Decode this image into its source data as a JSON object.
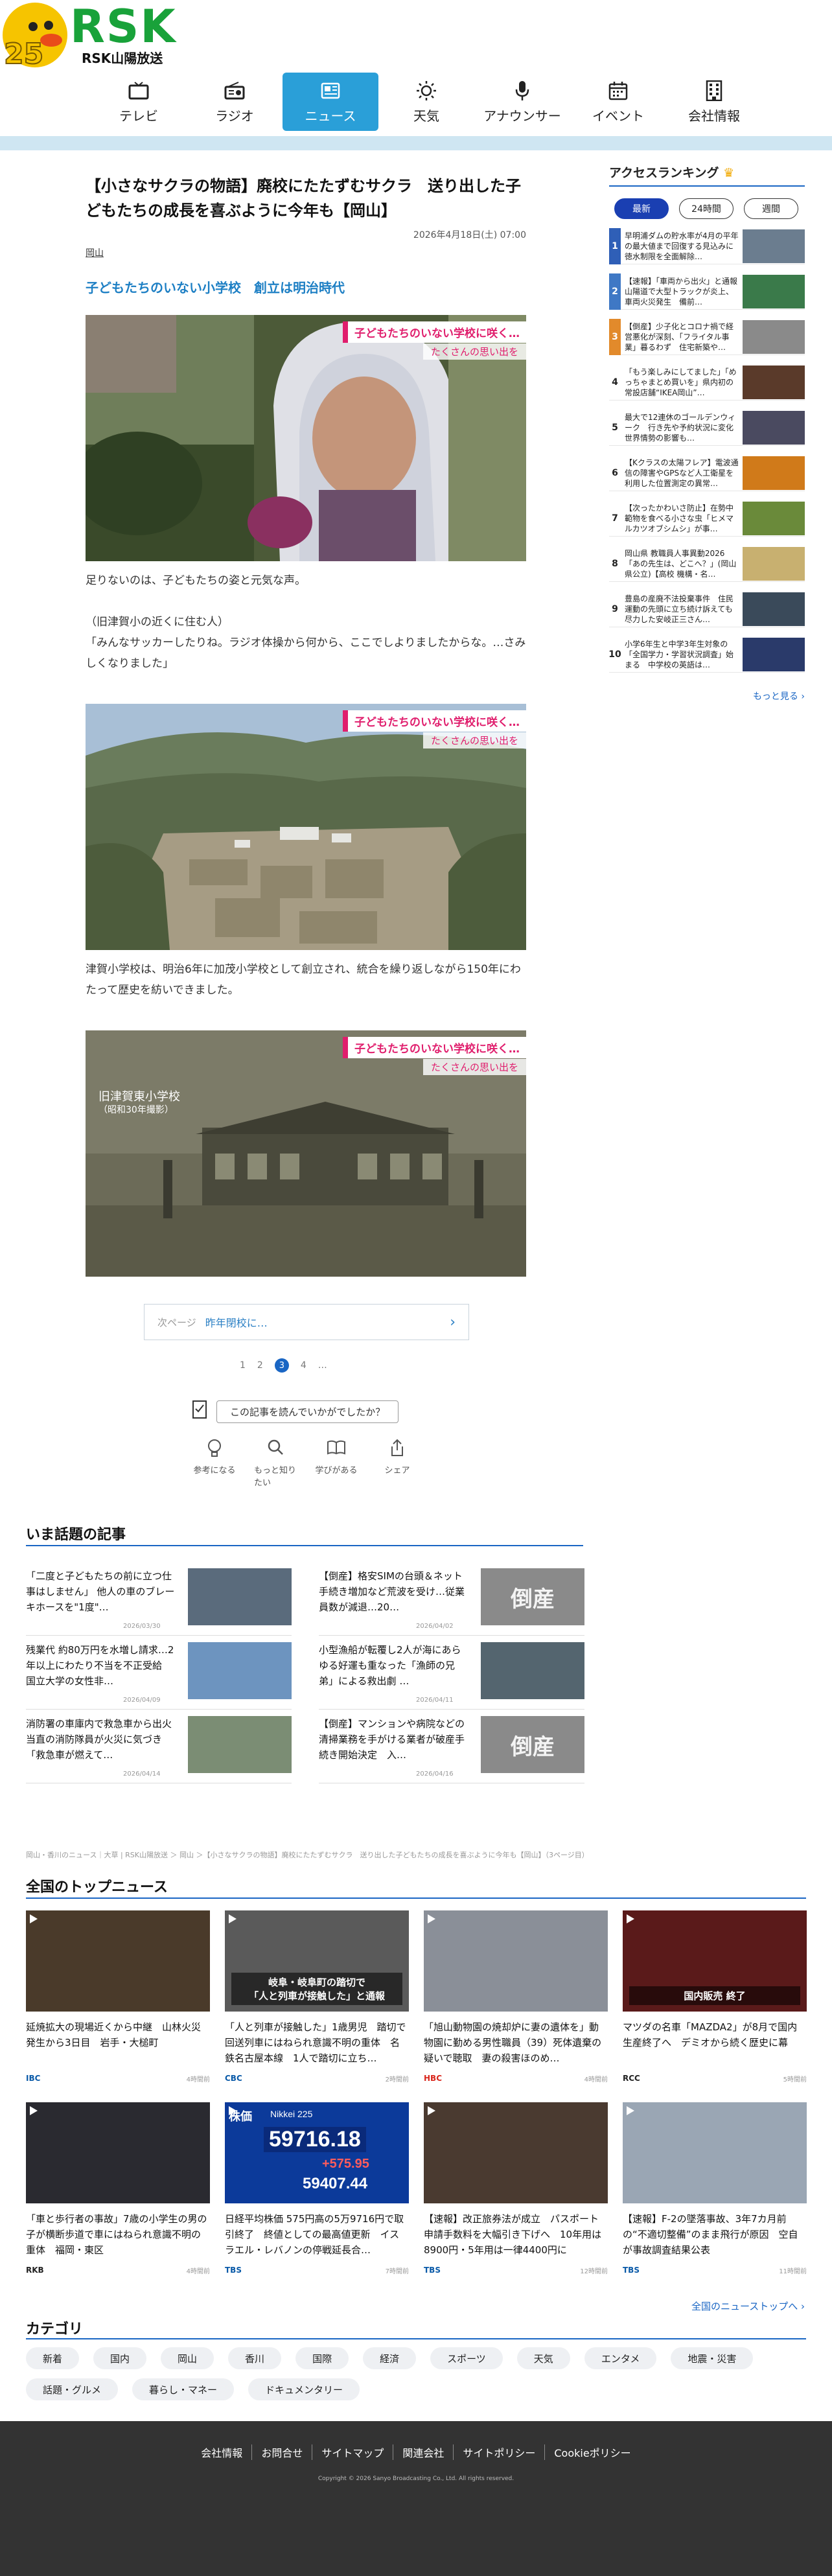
{
  "brand": {
    "logo_text": "RSK",
    "subtitle": "RSK山陽放送",
    "anniversary": "25"
  },
  "nav": [
    {
      "label": "テレビ",
      "icon": "tv-icon"
    },
    {
      "label": "ラジオ",
      "icon": "radio-icon"
    },
    {
      "label": "ニュース",
      "icon": "news-icon",
      "active": true
    },
    {
      "label": "天気",
      "icon": "sun-icon"
    },
    {
      "label": "アナウンサー",
      "icon": "microphone-icon"
    },
    {
      "label": "イベント",
      "icon": "calendar-icon"
    },
    {
      "label": "会社情報",
      "icon": "building-icon"
    }
  ],
  "article": {
    "title": "【小さなサクラの物語】廃校にたたずむサクラ　送り出した子どもたちの成長を喜ぶように今年も【岡山】",
    "date": "2026年4月18日(土) 07:00",
    "category": "岡山",
    "subheading": "子どもたちのいない小学校　創立は明治時代",
    "photo_caption_main": "子どもたちのいない学校に咲く…",
    "photo_caption_sub": "たくさんの思い出を",
    "photo3_label_line1": "旧津賀東小学校",
    "photo3_label_line2": "（昭和30年撮影）",
    "para1": "足りないのは、子どもたちの姿と元気な声。",
    "para2": "（旧津賀小の近くに住む人）\n「みんなサッカーしたりね。ラジオ体操から何から、ここでしよりましたからな。…さみしくなりました」",
    "para3": "津賀小学校は、明治6年に加茂小学校として創立され、統合を繰り返しながら150年にわたって歴史を紡いできました。"
  },
  "pager": {
    "next_label": "次ページ",
    "next_title": "昨年閉校に…",
    "pages": [
      "1",
      "2",
      "3",
      "4",
      "…"
    ],
    "current": "3"
  },
  "feedback": {
    "question": "この記事を読んでいかがでしたか？",
    "reactions": [
      {
        "label": "参考になる",
        "icon": "lightbulb-icon"
      },
      {
        "label": "もっと知りたい",
        "icon": "search-icon"
      },
      {
        "label": "学びがある",
        "icon": "book-icon"
      },
      {
        "label": "シェア",
        "icon": "share-icon"
      }
    ]
  },
  "sidebar": {
    "heading": "アクセスランキング",
    "tabs": [
      "最新",
      "24時間",
      "週間"
    ],
    "more": "もっと見る ›",
    "items": [
      {
        "rank": "1",
        "text": "早明浦ダムの貯水率が4月の平年の最大値まで回復する見込みに　徳水制限を全面解除…",
        "badge": "#2f5fb7"
      },
      {
        "rank": "2",
        "text": "【速報】「車両から出火」と通報　山陽道で大型トラックが炎上、車両火災発生　備前…",
        "badge": "#3f78c5"
      },
      {
        "rank": "3",
        "text": "【倒産】少子化とコロナ禍で経営悪化が深刻、「フライタル事業」暮るわず　住宅新築や…",
        "badge": "#e28a2b"
      },
      {
        "rank": "4",
        "text": "「もう楽しみにしてました」「めっちゃまとめ買いを」県内初の常設店舗“IKEA岡山”…",
        "badge": ""
      },
      {
        "rank": "5",
        "text": "最大で12連休のゴールデンウィーク　行き先や予約状況に変化　世界情勢の影響も…",
        "badge": ""
      },
      {
        "rank": "6",
        "text": "【Kクラスの太陽フレア】電波通信の障害やGPSなど人工衛星を利用した位置測定の異常…",
        "badge": ""
      },
      {
        "rank": "7",
        "text": "【次ったかわいさ防止】在勢中範物を食べる小さな虫「ヒメマルカツオブシムシ」が事…",
        "badge": ""
      },
      {
        "rank": "8",
        "text": "岡山県 教職員人事異動2026「あの先生は、どこへ？」(岡山県公立)【高校 機構・名…",
        "badge": ""
      },
      {
        "rank": "9",
        "text": "豊島の産廃不法投棄事件　住民運動の先頭に立ち続け訴えても尽力した安岐正三さん…",
        "badge": ""
      },
      {
        "rank": "10",
        "text": "小学6年生と中学3年生対象の「全国学力・学習状況調査」始まる　中学校の英語は…",
        "badge": ""
      }
    ]
  },
  "trending": {
    "heading": "いま話題の記事",
    "items": [
      {
        "title": "「二度と子どもたちの前に立つ仕事はしません」 他人の車のブレーキホースを\"1度\"…",
        "date": "2026/03/30",
        "img": "#5a6b7c"
      },
      {
        "title": "【倒産】格安SIMの台頭＆ネット手続き増加など荒波を受け…従業員数が減退…20…",
        "date": "2026/04/02",
        "img": "#8a8a8a",
        "img_text": "倒産"
      },
      {
        "title": "残業代 約80万円を水増し請求…2年以上にわたり不当を不正受給　国立大学の女性非…",
        "date": "2026/04/09",
        "img": "#6d94bf"
      },
      {
        "title": "小型漁船が転覆し2人が海にあらゆる好運も重なった「漁師の兄弟」による救出劇 …",
        "date": "2026/04/11",
        "img": "#54656f"
      },
      {
        "title": "消防署の車庫内で救急車から出火　当直の消防隊員が火災に気づき「救急車が燃えて…",
        "date": "2026/04/14",
        "img": "#7b8d74"
      },
      {
        "title": "【倒産】マンションや病院などの清掃業務を手がける業者が破産手続き開始決定　入…",
        "date": "2026/04/16",
        "img": "#8a8a8a",
        "img_text": "倒産"
      }
    ]
  },
  "breadcrumb": "岡山・香川のニュース｜大草 | RSK山陽放送 ＞ 岡山 ＞【小さなサクラの物語】廃校にたたずむサクラ　送り出した子どもたちの成長を喜ぶように今年も【岡山】（3ページ目）",
  "national": {
    "heading": "全国のトップニュース",
    "more": "全国のニューストップへ ›",
    "items": [
      {
        "title": "延焼拡大の現場近くから中継　山林火災発生から3日目　岩手・大槌町",
        "source": "IBC",
        "date": "4時間前",
        "img": "#4a3a2a",
        "color": "#0a5aa8"
      },
      {
        "title": "「人と列車が接触した」1歳男児　踏切で回送列車にはねられ意識不明の重体　名鉄名古屋本線　1人で踏切に立ち…",
        "source": "CBC",
        "date": "2時間前",
        "img": "#5a5a5a",
        "color": "#0a5aa8",
        "overlay": "岐阜・岐阜町の踏切で\n「人と列車が接触した」と通報"
      },
      {
        "title": "「旭山動物園の焼却炉に妻の遺体を」動物園に勤める男性職員（39）死体遺棄の疑いで聴取　妻の殺害ほのめ…",
        "source": "HBC",
        "date": "4時間前",
        "img": "#8a8f98",
        "color": "#d9261c"
      },
      {
        "title": "マツダの名車「MAZDA2」が8月で国内生産終了へ　デミオから続く歴史に幕",
        "source": "RCC",
        "date": "5時間前",
        "img": "#5a1a1a",
        "color": "#222",
        "overlay": "国内販売 終了"
      },
      {
        "title": "「車と歩行者の事故」7歳の小学生の男の子が横断歩道で車にはねられ意識不明の重体　福岡・東区",
        "source": "RKB",
        "date": "4時間前",
        "img": "#2a2a30",
        "color": "#222"
      },
      {
        "title": "日経平均株価 575円高の5万9716円で取引終了　終値としての最高値更新　イスラエル・レバノンの停戦延長合…",
        "source": "TBS",
        "date": "7時間前",
        "img": "#0c3a9a",
        "color": "#0a5aa8",
        "stock_label": "株価",
        "stock_index": "Nikkei 225",
        "stock_value": "59716.18",
        "stock_change": "+575.95",
        "stock_prev": "59407.44"
      },
      {
        "title": "【速報】改正旅券法が成立　パスポート申請手数料を大幅引き下げへ　10年用は8900円・5年用は一律4400円に",
        "source": "TBS",
        "date": "12時間前",
        "img": "#4a3a30",
        "color": "#0a5aa8"
      },
      {
        "title": "【速報】F-2の墜落事故、3年7カ月前の“不適切整備”のまま飛行が原因　空自が事故調査結果公表",
        "source": "TBS",
        "date": "11時間前",
        "img": "#9aa6b4",
        "color": "#0a5aa8"
      }
    ]
  },
  "categories": {
    "heading": "カテゴリ",
    "items": [
      "新着",
      "国内",
      "岡山",
      "香川",
      "国際",
      "経済",
      "スポーツ",
      "天気",
      "エンタメ",
      "地震・災害",
      "話題・グルメ",
      "暮らし・マネー",
      "ドキュメンタリー"
    ]
  },
  "footer": {
    "links": [
      "会社情報",
      "お問合せ",
      "サイトマップ",
      "関連会社",
      "サイトポリシー",
      "Cookieポリシー"
    ],
    "copyright": "Copyright © 2026 Sanyo Broadcasting Co., Ltd. All rights reserved."
  }
}
